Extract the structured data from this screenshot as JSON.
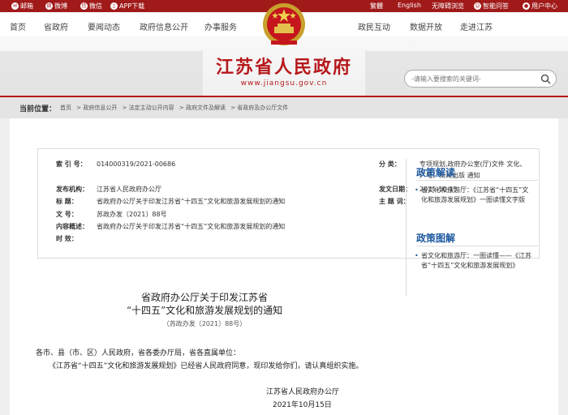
{
  "topbar": {
    "mail": "邮箱",
    "weibo": "微博",
    "wechat": "微信",
    "app": "APP下载",
    "trad": "繁體",
    "english": "English",
    "accessible": "无障碍浏览",
    "ai": "智能问答",
    "user": "用户中心"
  },
  "nav": {
    "left": [
      "首页",
      "省政府",
      "要闻动态",
      "政府信息公开",
      "办事服务"
    ],
    "right": [
      "政民互动",
      "数据开放",
      "走进江苏"
    ]
  },
  "brand": {
    "title": "江苏省人民政府",
    "url": "www.jiangsu.gov.cn"
  },
  "search": {
    "placeholder": "-请输入要搜索的关键词-"
  },
  "crumb": {
    "label": "当前位置：",
    "items": [
      "首页",
      "> 政府信息公开",
      "> 法定主动公开内容",
      "> 政府文件及解读",
      "> 省政府及办公厅文件"
    ]
  },
  "meta": {
    "index_k": "索 引 号：",
    "index_v": "014000319/2021-00686",
    "cat_k": "分      类：",
    "cat_v1": "专项规划,政府办公室(厅)文件 文化、",
    "cat_v2": "广电、新闻出版 通知",
    "org_k": "发布机构：",
    "org_v": "江苏省人民政府办公厅",
    "date_k": "发文日期：",
    "date_v": "2021-10-15",
    "title_k": "标      题：",
    "title_v": "省政府办公厅关于印发江苏省“十四五”文化和旅游发展规划的通知",
    "subject_k": "主 题 词：",
    "subject_v": "",
    "num_k": "文      号：",
    "num_v": "苏政办发〔2021〕88号",
    "content_k": "内容概述：",
    "content_v": "省政府办公厅关于印发江苏省“十四五”文化和旅游发展规划的通知",
    "time_k": "时      效：",
    "time_v": ""
  },
  "article": {
    "title1": "省政府办公厅关于印发江苏省",
    "title2": "“十四五”文化和旅游发展规划的通知",
    "docnum": "（苏政办发〔2021〕88号）",
    "recipients": "各市、县（市、区）人民政府，省各委办厅局，省各直属单位：",
    "body": "《江苏省“十四五”文化和旅游发展规划》已经省人民政府同意，现印发给你们，请认真组织实施。",
    "sign": "江苏省人民政府办公厅",
    "date": "2021年10月15日"
  },
  "side": {
    "h1": "政策解读",
    "i1": "省文化和旅游厅：《江苏省“十四五”文化和旅游发展规划》一图读懂文字版",
    "h2": "政策图解",
    "i2": "省文化和旅游厅：一图读懂——《江苏省“十四五”文化和旅游发展规划》"
  },
  "colors": {
    "brand_red": "#b7191c",
    "topbar": "#a11a1a",
    "link_blue": "#1e5aa0"
  },
  "icons": [
    "mail-icon",
    "weibo-icon",
    "wechat-icon",
    "app-icon",
    "accessibility-icon",
    "robot-icon",
    "user-icon",
    "search-icon",
    "national-emblem"
  ]
}
